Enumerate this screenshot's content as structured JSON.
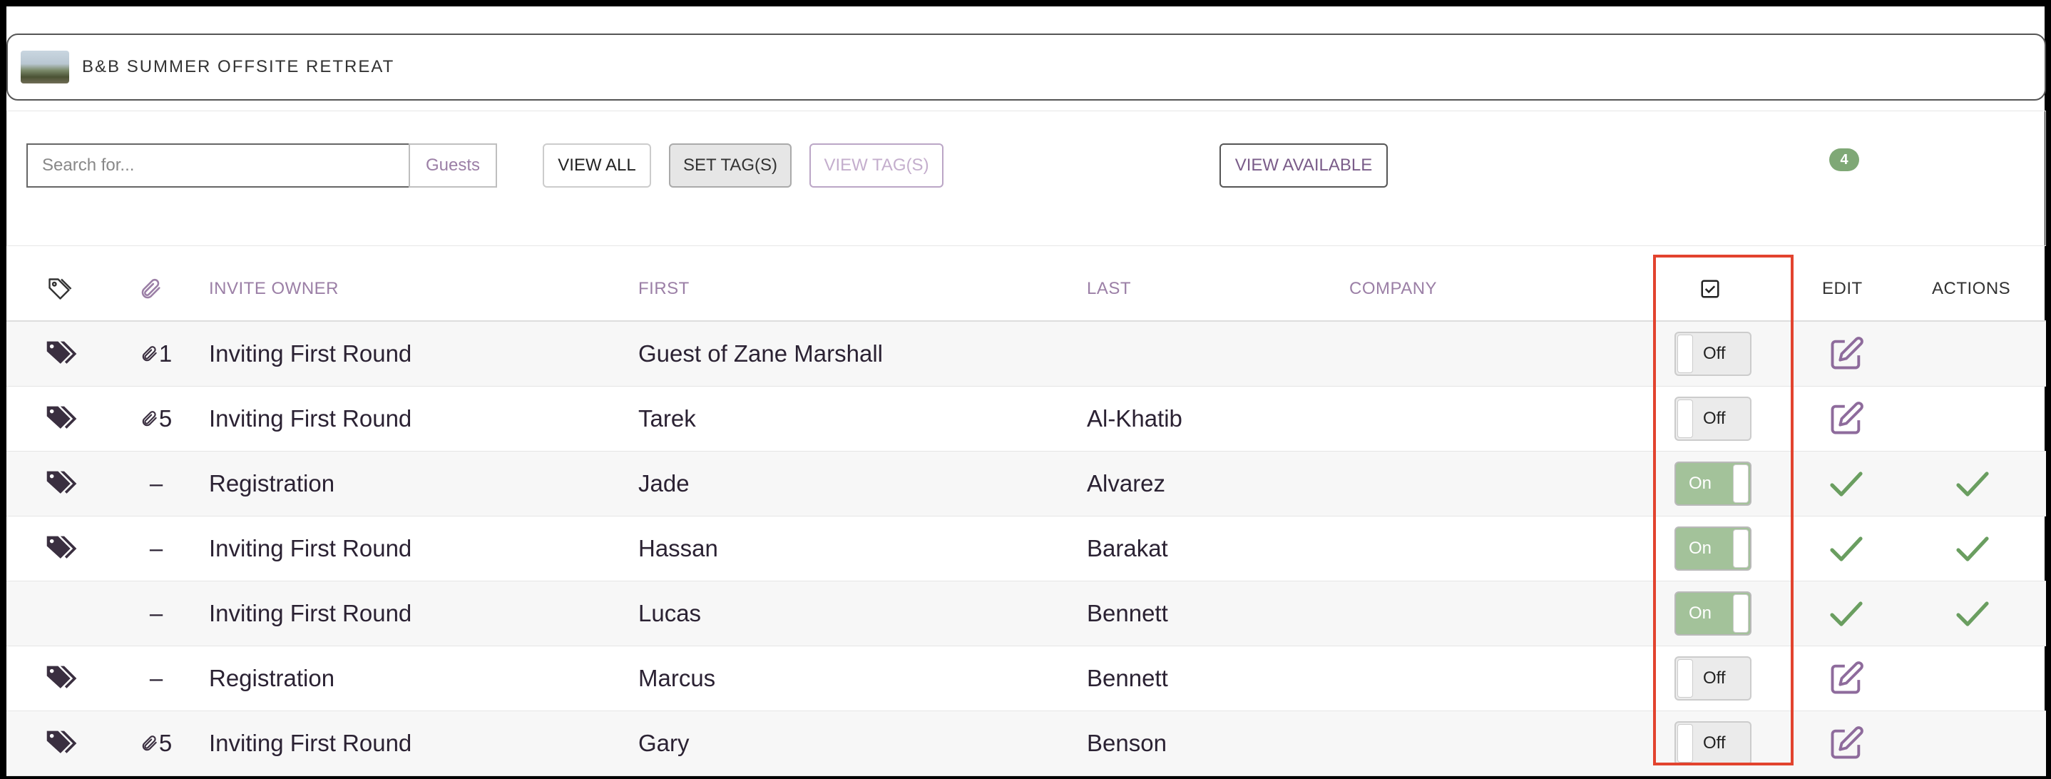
{
  "event": {
    "title": "B&B SUMMER OFFSITE RETREAT"
  },
  "toolbar": {
    "search_placeholder": "Search for...",
    "search_scope": "Guests",
    "view_all": "VIEW ALL",
    "set_tags": "SET TAG(S)",
    "view_tags": "VIEW TAG(S)",
    "view_available": "VIEW AVAILABLE",
    "count": "4"
  },
  "table": {
    "headers": {
      "invite_owner": "INVITE OWNER",
      "first": "FIRST",
      "last": "LAST",
      "company": "COMPANY",
      "edit": "EDIT",
      "actions": "ACTIONS"
    },
    "rows": [
      {
        "tagged": true,
        "attachments": "1",
        "invite_owner": "Inviting First Round",
        "first": "Guest of Zane Marshall",
        "last": "",
        "company": "",
        "toggle": "Off",
        "edit": "edit",
        "action": ""
      },
      {
        "tagged": true,
        "attachments": "5",
        "invite_owner": "Inviting First Round",
        "first": "Tarek",
        "last": "Al-Khatib",
        "company": "",
        "toggle": "Off",
        "edit": "edit",
        "action": ""
      },
      {
        "tagged": true,
        "attachments": "–",
        "invite_owner": "Registration",
        "first": "Jade",
        "last": "Alvarez",
        "company": "",
        "toggle": "On",
        "edit": "check",
        "action": "check"
      },
      {
        "tagged": true,
        "attachments": "–",
        "invite_owner": "Inviting First Round",
        "first": "Hassan",
        "last": "Barakat",
        "company": "",
        "toggle": "On",
        "edit": "check",
        "action": "check"
      },
      {
        "tagged": false,
        "attachments": "–",
        "invite_owner": "Inviting First Round",
        "first": "Lucas",
        "last": "Bennett",
        "company": "",
        "toggle": "On",
        "edit": "check",
        "action": "check"
      },
      {
        "tagged": true,
        "attachments": "–",
        "invite_owner": "Registration",
        "first": "Marcus",
        "last": "Bennett",
        "company": "",
        "toggle": "Off",
        "edit": "edit",
        "action": ""
      },
      {
        "tagged": true,
        "attachments": "5",
        "invite_owner": "Inviting First Round",
        "first": "Gary",
        "last": "Benson",
        "company": "",
        "toggle": "Off",
        "edit": "edit",
        "action": ""
      }
    ]
  },
  "colors": {
    "accent_purple": "#9b7fa6",
    "toggle_on": "#a3c29a",
    "check_green": "#6a9e60",
    "highlight_red": "#e2432e"
  }
}
